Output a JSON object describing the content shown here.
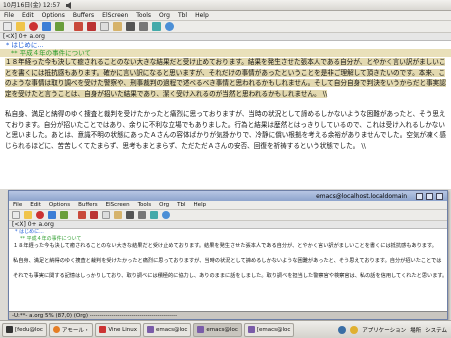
{
  "top_panel": {
    "clock": "10月16日(金) 12:57"
  },
  "menu_items": [
    "File",
    "Edit",
    "Options",
    "Buffers",
    "ElScreen",
    "Tools",
    "Org",
    "Tbl",
    "Help"
  ],
  "tabline": "[<X] 0+ a.org",
  "doc": {
    "h1": "* はじめに...",
    "h2": "** 平成４年の事件について",
    "p1": "１８年経った今も決して癒されることのない大きな結果だと受け止めております。結果を発生させた張本人である自分が、とやかく言い訳がましいことを書くには抵抗感もあります。確かに言い訳になると思いますが、それだけの事情があったということを是非ご理解して頂きたいのです。本来、このような事情は取り調べを受けた警察や、刑事裁判の過程で述べるべき事情と思われるかもしれません。そして自分自身で判決をいうからだと事実認定を受けたと言うことは、自身が招いた結果であり、潔く受け入れるのが当然と思われるかもしれません。 \\\\",
    "p2": "私自身、満足と納得のゆく捜査と裁判を受けたかったと痛烈に思っておりますが、当時の状況として諦めるしかないような困難があったと、そう思えております。自分が招いたことではあり、余りに不利な立場でもありました。行為と結果は歴然とはっきりしているので、これは受け入れるしかないと思いました。あとは、意識不明の状態にあったＡさんの容体ばかりが気掛かりで、冷静に償い根拠を考える余裕がありませんでした。空気が凍く感じられるほどに、苦苦しくてたまらず、思考もまとまらず、ただただＡさんの安否、回復を祈祷するという状態でした。 \\\\"
  },
  "win2": {
    "title": "emacs@localhost.localdomain",
    "tabline": "[<X] 0+ a.org",
    "h1": "* はじめに...",
    "h2": "** 平成４年の事件について",
    "line1": "１８年経った今も決して癒されることのない大きな結果だと受け止めております。結果を発生させた張本人である自分が、とやかく言い訳がましいことを書くには抵抗感もあります。",
    "line2": "私自身、満足と納得のゆく捜査と裁判を受けたかったと痛烈に思っておりますが、当時の状況として諦めるしかないような困難があったと、そう思えております。自分が招いたことでは",
    "line3": "それでも事実に関する記憶はしっかりしており、取り調べには積極的に協力し、ありのままに話をしました。取り調べを担当した警察官や検察官は、私の話を信用してくれたと思います。",
    "modeline": "-U:**-  a.org    5% (87,0)   (Org) --------------------------------------------"
  },
  "win1_title": "emacs@localhost.localdomain",
  "taskbar": {
    "tasks": [
      "[fedu@loc",
      "アモール・",
      "Vine Linux",
      "emacs@loc",
      "emacs@loc",
      "[emacs@loc"
    ],
    "tray_app": "アプリケーション",
    "tray_place": "場所",
    "tray_system": "システム"
  }
}
